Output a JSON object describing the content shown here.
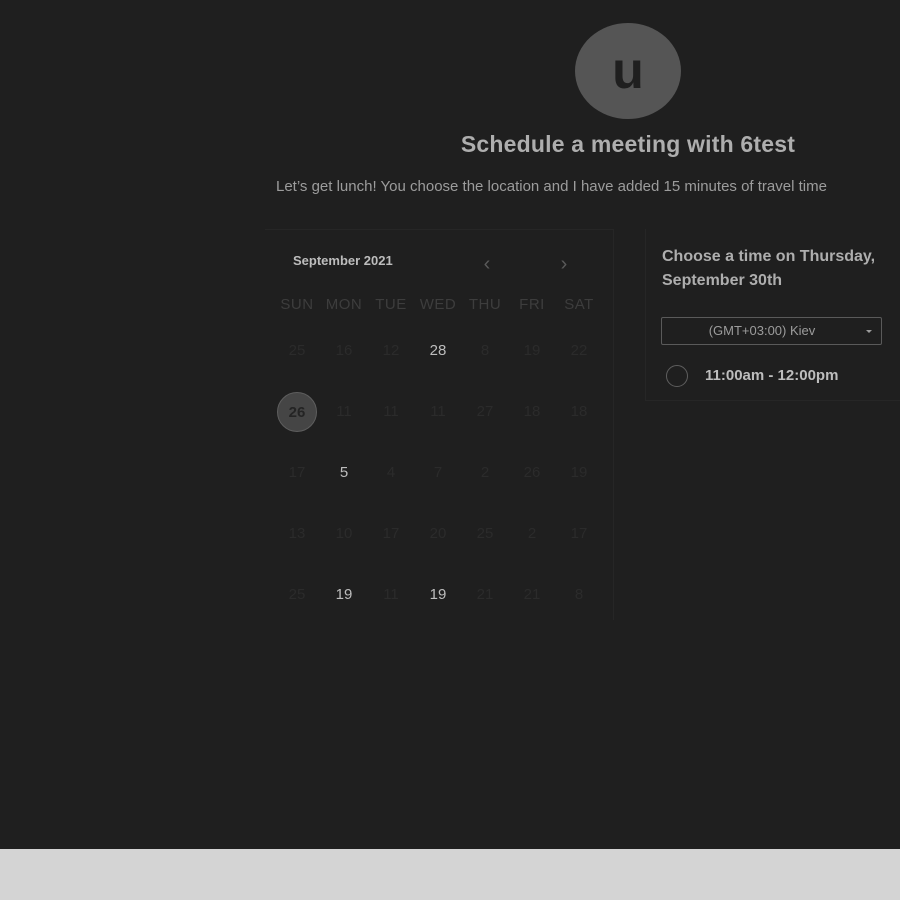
{
  "avatar": {
    "initial": "u"
  },
  "title": "Schedule a meeting with 6test",
  "subtitle": "Let’s get lunch! You choose the location and I have added 15 minutes of travel time",
  "calendar": {
    "month_label": "September 2021",
    "prev_icon": "chevron-left-icon",
    "next_icon": "chevron-right-icon",
    "weekdays": [
      "SUN",
      "MON",
      "TUE",
      "WED",
      "THU",
      "FRI",
      "SAT"
    ],
    "weeks": [
      [
        {
          "d": "25",
          "on": false
        },
        {
          "d": "16",
          "on": false
        },
        {
          "d": "12",
          "on": false
        },
        {
          "d": "28",
          "on": true
        },
        {
          "d": "8",
          "on": false
        },
        {
          "d": "19",
          "on": false
        },
        {
          "d": "22",
          "on": false
        }
      ],
      [
        {
          "d": "26",
          "on": true,
          "selected": true
        },
        {
          "d": "11",
          "on": false
        },
        {
          "d": "11",
          "on": false
        },
        {
          "d": "11",
          "on": false
        },
        {
          "d": "27",
          "on": false
        },
        {
          "d": "18",
          "on": false
        },
        {
          "d": "18",
          "on": false
        }
      ],
      [
        {
          "d": "17",
          "on": false
        },
        {
          "d": "5",
          "on": true
        },
        {
          "d": "4",
          "on": false
        },
        {
          "d": "7",
          "on": false
        },
        {
          "d": "2",
          "on": false
        },
        {
          "d": "26",
          "on": false
        },
        {
          "d": "19",
          "on": false
        }
      ],
      [
        {
          "d": "13",
          "on": false
        },
        {
          "d": "10",
          "on": false
        },
        {
          "d": "17",
          "on": false
        },
        {
          "d": "20",
          "on": false
        },
        {
          "d": "25",
          "on": false
        },
        {
          "d": "2",
          "on": false
        },
        {
          "d": "17",
          "on": false
        }
      ],
      [
        {
          "d": "25",
          "on": false
        },
        {
          "d": "19",
          "on": true
        },
        {
          "d": "11",
          "on": false
        },
        {
          "d": "19",
          "on": true
        },
        {
          "d": "21",
          "on": false
        },
        {
          "d": "21",
          "on": false
        },
        {
          "d": "8",
          "on": false
        }
      ]
    ]
  },
  "times": {
    "heading": "Choose a time on Thursday, September 30th",
    "timezone": "(GMT+03:00) Kiev",
    "slots": [
      {
        "label": "11:00am - 12:00pm"
      }
    ]
  },
  "colors": {
    "background": "#1f1f1f",
    "footer": "#d4d4d4"
  }
}
